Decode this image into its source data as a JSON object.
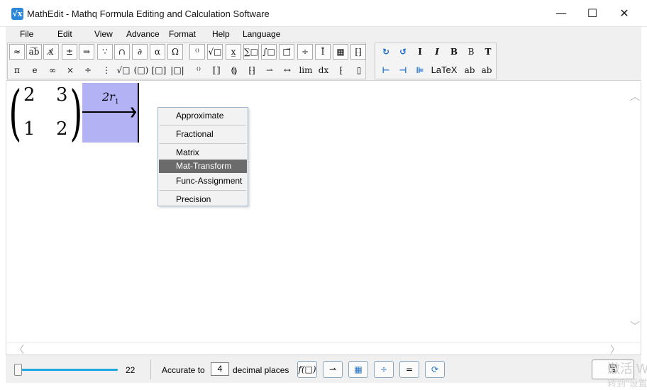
{
  "window": {
    "title": "MathEdit - Mathq Formula Editing and Calculation Software",
    "icon_glyph": "√x",
    "minimize_glyph": "—",
    "maximize_glyph": "☐",
    "close_glyph": "✕"
  },
  "menu": [
    "File",
    "Edit",
    "View",
    "Advance",
    "Format",
    "Help",
    "Language"
  ],
  "toolbar": {
    "row1": [
      "≈",
      "a͡b",
      "x̸",
      "±",
      "⇒",
      "∵",
      "∩",
      "∂",
      "α",
      "Ω",
      "⁽⁾",
      "√□",
      "x̲",
      "∑□",
      "∫□",
      "□⃗",
      "÷",
      "Ī",
      "▦",
      "⁅⁆"
    ],
    "row2": [
      "π",
      "e",
      "∞",
      "×",
      "÷",
      "⋮",
      "√□",
      "(□)",
      "[□]",
      "|□|",
      "⁽⁾",
      "⟦⟧",
      "⟬⟭",
      "⁅⁆",
      "⇀",
      "↔",
      "lim",
      "dx",
      "⁅",
      "▯"
    ],
    "format_row1": [
      "↻",
      "↺",
      "I",
      "I",
      "B",
      "B",
      "T"
    ],
    "format_row2": [
      "⊢",
      "⊣",
      "⊫",
      "LaTeX",
      "ab",
      "ab"
    ]
  },
  "matrix": {
    "rows": [
      [
        "2",
        "3"
      ],
      [
        "1",
        "2"
      ]
    ],
    "transform_coef": "2r",
    "transform_sub": "1"
  },
  "context_menu": {
    "items": [
      "Approximate",
      "Fractional",
      "Matrix",
      "Mat-Transform",
      "Func-Assignment",
      "Precision"
    ],
    "active": "Mat-Transform"
  },
  "scroll": {
    "up": "︿",
    "down": "﹀",
    "left": "〈",
    "right": "〉"
  },
  "bottom": {
    "zoom_value": "22",
    "accurate_to_label": "Accurate to",
    "decimal_places": "4",
    "decimal_places_label": "decimal places",
    "buttons": [
      "f(□)",
      "⇀",
      "▦",
      "÷",
      "=",
      "⟳"
    ],
    "save_icon": "🖫"
  },
  "watermark": {
    "line1": "激活 W",
    "line2": "转到\"设置\""
  },
  "colors": {
    "accent_blue": "#2d87d8",
    "selection_purple": "#b2b2f5",
    "menu_active": "#6b6b6b",
    "slider_blue": "#1ea7e1"
  }
}
